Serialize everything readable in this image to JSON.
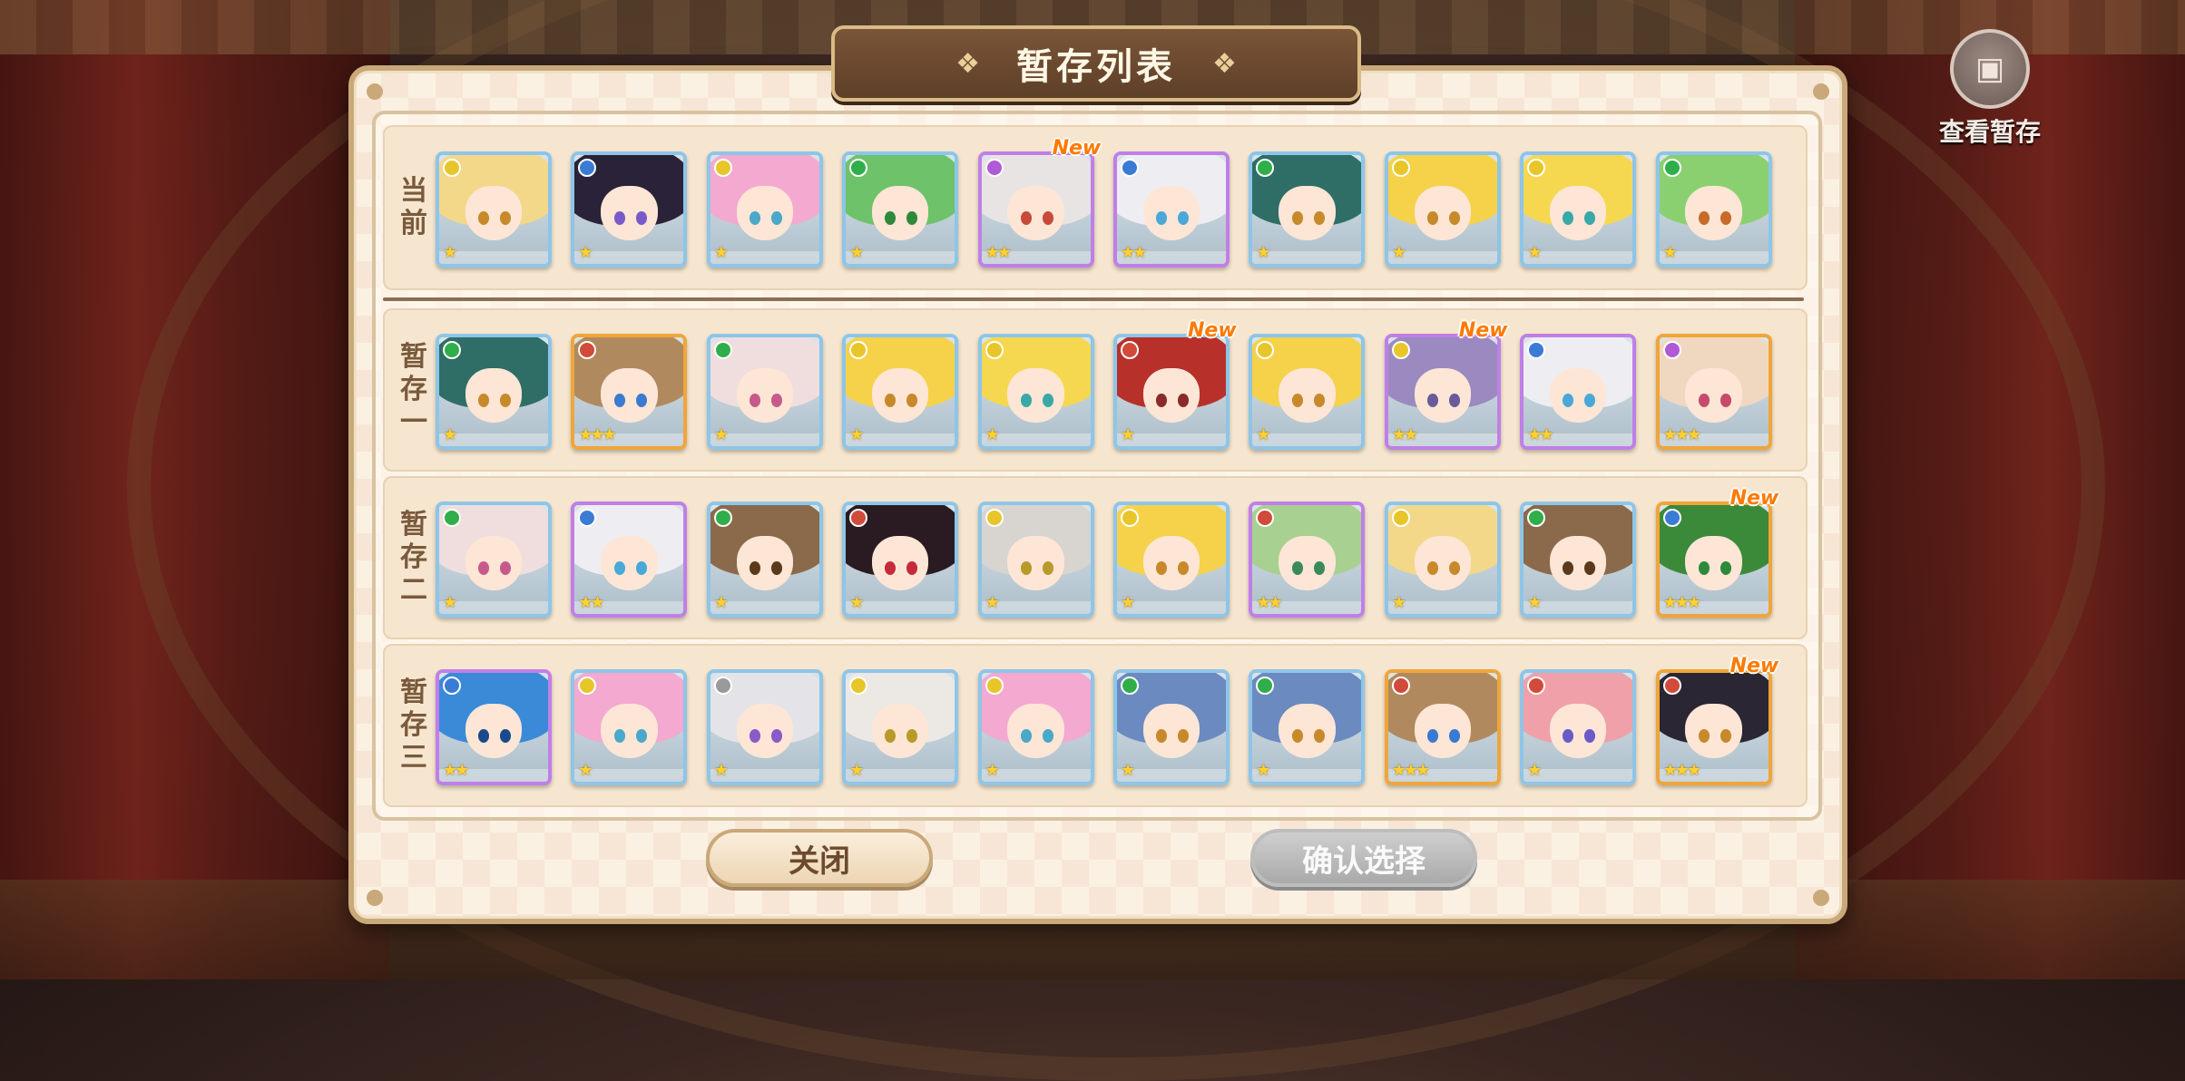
{
  "title": "暂存列表",
  "view_saved_label": "查看暂存",
  "buttons": {
    "close": "关闭",
    "confirm": "确认选择"
  },
  "new_label": "New",
  "rows": [
    {
      "label": "当\n前",
      "cards": [
        {
          "rarity": 1,
          "attr": "#e8c62a",
          "hair": "#f3d88a",
          "eye": "#c7892a"
        },
        {
          "rarity": 1,
          "attr": "#3a7bd5",
          "hair": "#2a2238",
          "eye": "#7a5ac8"
        },
        {
          "rarity": 1,
          "attr": "#e8c62a",
          "hair": "#f3a9d0",
          "eye": "#4aa8c8"
        },
        {
          "rarity": 1,
          "attr": "#2fae4a",
          "hair": "#6ec26a",
          "eye": "#2e8a3a"
        },
        {
          "rarity": 2,
          "attr": "#b05ad6",
          "hair": "#e8e4e4",
          "eye": "#c74a3a",
          "new": true
        },
        {
          "rarity": 2,
          "attr": "#3a7bd5",
          "hair": "#eeeef2",
          "eye": "#4aa8d8"
        },
        {
          "rarity": 1,
          "attr": "#2fae4a",
          "hair": "#2f6e66",
          "eye": "#c78a2a"
        },
        {
          "rarity": 1,
          "attr": "#e8c62a",
          "hair": "#f5d24a",
          "eye": "#c7892a"
        },
        {
          "rarity": 1,
          "attr": "#e8c62a",
          "hair": "#f5d850",
          "eye": "#3aa8a8"
        },
        {
          "rarity": 1,
          "attr": "#2fae4a",
          "hair": "#8ad070",
          "eye": "#c76a2a"
        }
      ]
    },
    {
      "label": "暂\n存\n一",
      "cards": [
        {
          "rarity": 1,
          "attr": "#2fae4a",
          "hair": "#2f6e66",
          "eye": "#c78a2a"
        },
        {
          "rarity": 3,
          "attr": "#d14a3a",
          "hair": "#b08a5e",
          "eye": "#3a7ad0"
        },
        {
          "rarity": 1,
          "attr": "#2fae4a",
          "hair": "#f0dede",
          "eye": "#c75a8a"
        },
        {
          "rarity": 1,
          "attr": "#e8c62a",
          "hair": "#f5d24a",
          "eye": "#c7892a"
        },
        {
          "rarity": 1,
          "attr": "#e8c62a",
          "hair": "#f5d850",
          "eye": "#3aa8a8"
        },
        {
          "rarity": 1,
          "attr": "#d14a3a",
          "hair": "#b8302a",
          "eye": "#8a2a2a",
          "new": true
        },
        {
          "rarity": 1,
          "attr": "#e8c62a",
          "hair": "#f5d24a",
          "eye": "#c7892a"
        },
        {
          "rarity": 2,
          "attr": "#e8c62a",
          "hair": "#9a8ac0",
          "eye": "#6a5a9a",
          "new": true
        },
        {
          "rarity": 2,
          "attr": "#3a7bd5",
          "hair": "#eeeef2",
          "eye": "#4aa8d8"
        },
        {
          "rarity": 3,
          "attr": "#b05ad6",
          "hair": "#f0d8c0",
          "eye": "#c74a6a"
        }
      ]
    },
    {
      "label": "暂\n存\n二",
      "cards": [
        {
          "rarity": 1,
          "attr": "#2fae4a",
          "hair": "#f0dede",
          "eye": "#c75a8a"
        },
        {
          "rarity": 2,
          "attr": "#3a7bd5",
          "hair": "#eeeef2",
          "eye": "#4aa8d8"
        },
        {
          "rarity": 1,
          "attr": "#2fae4a",
          "hair": "#8a6a4a",
          "eye": "#5a3a1a"
        },
        {
          "rarity": 1,
          "attr": "#d14a3a",
          "hair": "#2a1a22",
          "eye": "#c72a3a"
        },
        {
          "rarity": 1,
          "attr": "#e8c62a",
          "hair": "#d8d4d0",
          "eye": "#b89a2a"
        },
        {
          "rarity": 1,
          "attr": "#e8c62a",
          "hair": "#f5d24a",
          "eye": "#c7892a"
        },
        {
          "rarity": 2,
          "attr": "#d14a3a",
          "hair": "#a8d090",
          "eye": "#3a8a5a"
        },
        {
          "rarity": 1,
          "attr": "#e8c62a",
          "hair": "#f3d88a",
          "eye": "#c7892a"
        },
        {
          "rarity": 1,
          "attr": "#2fae4a",
          "hair": "#8a6a4a",
          "eye": "#5a3a1a"
        },
        {
          "rarity": 3,
          "attr": "#3a7bd5",
          "hair": "#3a8a3a",
          "eye": "#2e8a3a",
          "new": true
        }
      ]
    },
    {
      "label": "暂\n存\n三",
      "cards": [
        {
          "rarity": 2,
          "attr": "#3a7bd5",
          "hair": "#3a8ad8",
          "eye": "#1a4a8a"
        },
        {
          "rarity": 1,
          "attr": "#e8c62a",
          "hair": "#f3a9d0",
          "eye": "#4aa8c8"
        },
        {
          "rarity": 1,
          "attr": "#9a9a9a",
          "hair": "#e4e4e8",
          "eye": "#8a5ac8"
        },
        {
          "rarity": 1,
          "attr": "#e8c62a",
          "hair": "#ece8e4",
          "eye": "#b89a2a"
        },
        {
          "rarity": 1,
          "attr": "#e8c62a",
          "hair": "#f3a9d0",
          "eye": "#4aa8c8"
        },
        {
          "rarity": 1,
          "attr": "#2fae4a",
          "hair": "#6a8ac0",
          "eye": "#c7892a"
        },
        {
          "rarity": 1,
          "attr": "#2fae4a",
          "hair": "#6a8ac0",
          "eye": "#c7892a"
        },
        {
          "rarity": 3,
          "attr": "#d14a3a",
          "hair": "#b08a5e",
          "eye": "#3a7ad0"
        },
        {
          "rarity": 1,
          "attr": "#d14a3a",
          "hair": "#f0a0a8",
          "eye": "#6a5ac8"
        },
        {
          "rarity": 3,
          "attr": "#d14a3a",
          "hair": "#2a2634",
          "eye": "#c7892a",
          "new": true
        }
      ]
    }
  ]
}
